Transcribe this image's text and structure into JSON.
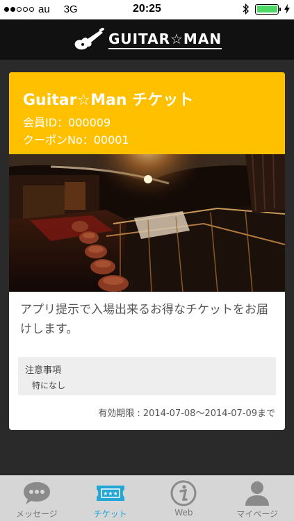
{
  "status_bar": {
    "carrier": "au",
    "network": "3G",
    "time": "20:25",
    "battery_level": 1.0
  },
  "header": {
    "logo_text": "GUITAR☆MAN"
  },
  "ticket": {
    "title": "Guitar☆Man チケット",
    "member_id": "会員ID：000009",
    "coupon_no": "クーポンNo：00001",
    "description": "アプリ提示で入場出来るお得なチケットをお届けします。",
    "notice_title": "注意事項",
    "notice_body": "特になし",
    "validity": "有効期限 : 2014-07-08〜2014-07-09まで"
  },
  "tabbar": {
    "items": [
      {
        "label": "メッセージ",
        "icon": "speech-bubble-icon",
        "active": false
      },
      {
        "label": "チケット",
        "icon": "ticket-icon",
        "active": true
      },
      {
        "label": "Web",
        "icon": "info-icon",
        "active": false
      },
      {
        "label": "マイページ",
        "icon": "person-icon",
        "active": false
      }
    ]
  },
  "colors": {
    "ticket_header": "#ffc000",
    "tab_active": "#22a6d6",
    "battery": "#4cd964"
  }
}
